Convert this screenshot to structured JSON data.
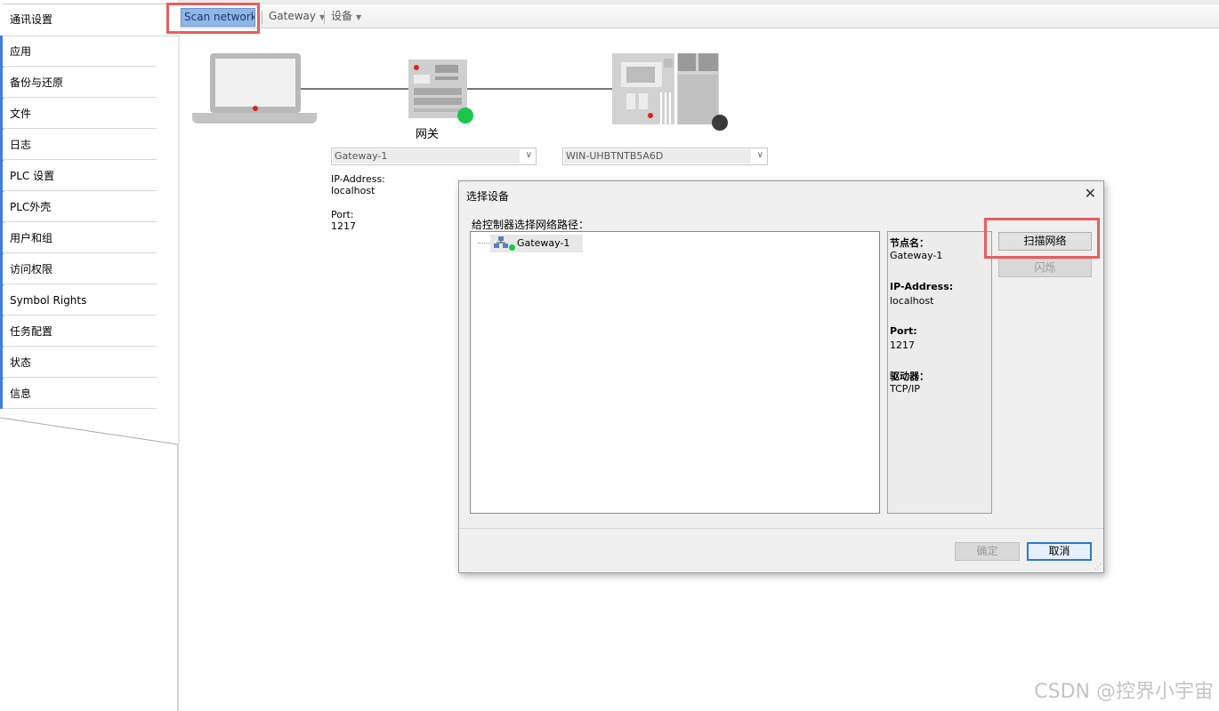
{
  "sidebar": {
    "items": [
      {
        "label": "通讯设置",
        "active": true
      },
      {
        "label": "应用"
      },
      {
        "label": "备份与还原"
      },
      {
        "label": "文件"
      },
      {
        "label": "日志"
      },
      {
        "label": "PLC 设置"
      },
      {
        "label": "PLC外壳"
      },
      {
        "label": "用户和组"
      },
      {
        "label": "访问权限"
      },
      {
        "label": "Symbol Rights"
      },
      {
        "label": "任务配置"
      },
      {
        "label": "状态"
      },
      {
        "label": "信息"
      }
    ]
  },
  "toolbar": {
    "scan_network": "Scan network...",
    "gateway": "Gateway",
    "device": "设备"
  },
  "topology": {
    "gateway_caption": "网关",
    "gateway_select": "Gateway-1",
    "device_select": "WIN-UHBTNTB5A6D",
    "ip_label": "IP-Address:",
    "ip_value": "localhost",
    "port_label": "Port:",
    "port_value": "1217",
    "gateway_status_color": "#19c84a",
    "device_status_color": "#3a3a3a"
  },
  "dialog": {
    "title": "选择设备",
    "prompt": "给控制器选择网络路径：",
    "tree_node": "Gateway-1",
    "details": {
      "node_name_label": "节点名：",
      "node_name_value": "Gateway-1",
      "ip_label": "IP-Address:",
      "ip_value": "localhost",
      "port_label": "Port:",
      "port_value": "1217",
      "driver_label": "驱动器：",
      "driver_value": "TCP/IP"
    },
    "scan_button": "扫描网络",
    "blink_button": "闪烁",
    "ok_button": "确定",
    "cancel_button": "取消"
  },
  "watermark": "CSDN @控界小宇宙"
}
